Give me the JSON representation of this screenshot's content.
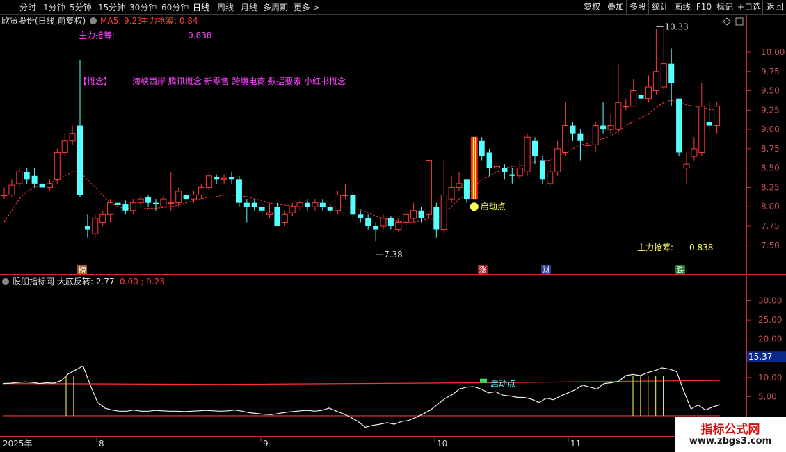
{
  "toolbar": {
    "periods": [
      "分时",
      "1分钟",
      "5分钟",
      "15分钟",
      "30分钟",
      "60分钟",
      "日线",
      "周线",
      "月线",
      "多周期",
      "更多 >"
    ],
    "active_period": "日线",
    "right_buttons": [
      "复权",
      "叠加",
      "多股",
      "统计",
      "画线",
      "F10",
      "标记",
      "+自选",
      "返回"
    ]
  },
  "main": {
    "stock_title": "欣贸股份(日线,前复权)",
    "ma_label": "MA5: 9.23",
    "zl_header": "主力抢筹: 0.84",
    "zl_label": "主力抢筹:",
    "zl_value": "0.838",
    "concept_tag": "【概念】",
    "concepts": "海峡西岸 腾讯概念 新零售 跨境电商 数据要素 小红书概念",
    "start_point_label": "启动点",
    "high_label": "10.33",
    "low_label": "7.38",
    "zl_bottom_label": "主力抢筹:",
    "zl_bottom_value": "0.838",
    "badges": [
      "榜",
      "涨",
      "财",
      "跌"
    ],
    "y_axis": [
      "10.00",
      "9.75",
      "9.50",
      "9.25",
      "9.00",
      "8.75",
      "8.50",
      "8.25",
      "8.00",
      "7.75",
      "7.50"
    ]
  },
  "sub": {
    "indicator_name": "股朋指标网",
    "series_label": "大底反转: 2.77",
    "values_text": "0.00 ; 9.23",
    "start_point_label": "启动点",
    "y_axis": [
      "30.00",
      "25.00",
      "20.00",
      "10.00",
      "5.00"
    ],
    "current_value": "15.37"
  },
  "x_axis": {
    "labels": [
      "2025年",
      "8",
      "9",
      "10",
      "11"
    ]
  },
  "watermark": {
    "title": "指标公式网",
    "url": "www.zbgs3.com"
  },
  "colors": {
    "up": "#ff3a3a",
    "down": "#54ffff",
    "ma": "#ff3a3a",
    "zl": "#ff44ff",
    "gold": "#ffff55",
    "axis": "#c03030"
  },
  "chart_data": {
    "type": "candlestick",
    "title": "欣贸股份(日线,前复权)",
    "ylim": [
      7.3,
      10.45
    ],
    "candles": [
      [
        8.15,
        8.15,
        8.25,
        8.1
      ],
      [
        8.15,
        8.28,
        8.35,
        8.12
      ],
      [
        8.3,
        8.45,
        8.5,
        8.25
      ],
      [
        8.45,
        8.35,
        8.5,
        8.3
      ],
      [
        8.4,
        8.3,
        8.5,
        8.25
      ],
      [
        8.3,
        8.25,
        8.35,
        8.2
      ],
      [
        8.25,
        8.3,
        8.35,
        8.2
      ],
      [
        8.35,
        8.7,
        8.75,
        8.3
      ],
      [
        8.7,
        8.85,
        8.95,
        8.65
      ],
      [
        8.85,
        8.95,
        9.05,
        8.8
      ],
      [
        9.05,
        8.15,
        9.9,
        8.12
      ],
      [
        7.75,
        7.7,
        7.9,
        7.6
      ],
      [
        7.65,
        7.85,
        7.9,
        7.6
      ],
      [
        7.8,
        7.9,
        7.95,
        7.75
      ],
      [
        7.9,
        8.05,
        8.1,
        7.8
      ],
      [
        8.05,
        8.02,
        8.1,
        7.95
      ],
      [
        8.03,
        7.95,
        8.08,
        7.9
      ],
      [
        7.95,
        8.05,
        8.1,
        7.9
      ],
      [
        8.05,
        8.1,
        8.15,
        8.0
      ],
      [
        8.12,
        8.05,
        8.15,
        8.0
      ],
      [
        8.05,
        8.03,
        8.1,
        7.95
      ],
      [
        8.0,
        8.1,
        8.15,
        7.98
      ],
      [
        8.05,
        8.05,
        8.45,
        7.95
      ],
      [
        8.05,
        8.2,
        8.25,
        8.0
      ],
      [
        8.15,
        8.1,
        8.2,
        8.0
      ],
      [
        8.1,
        8.15,
        8.2,
        8.05
      ],
      [
        8.15,
        8.25,
        8.3,
        8.1
      ],
      [
        8.25,
        8.4,
        8.45,
        8.2
      ],
      [
        8.38,
        8.35,
        8.42,
        8.3
      ],
      [
        8.35,
        8.37,
        8.42,
        8.3
      ],
      [
        8.38,
        8.35,
        8.45,
        8.3
      ],
      [
        8.35,
        8.05,
        8.4,
        8.0
      ],
      [
        8.05,
        8.0,
        8.1,
        7.8
      ],
      [
        8.05,
        8.0,
        8.1,
        7.95
      ],
      [
        8.0,
        7.95,
        8.05,
        7.85
      ],
      [
        7.9,
        7.92,
        8.05,
        7.85
      ],
      [
        8.0,
        7.75,
        8.05,
        7.75
      ],
      [
        7.8,
        7.9,
        7.95,
        7.75
      ],
      [
        7.92,
        8.0,
        8.05,
        7.88
      ],
      [
        8.0,
        8.05,
        8.1,
        7.95
      ],
      [
        8.05,
        8.0,
        8.1,
        7.95
      ],
      [
        8.0,
        8.05,
        8.1,
        7.95
      ],
      [
        8.05,
        8.0,
        8.1,
        7.95
      ],
      [
        8.0,
        7.95,
        8.05,
        7.9
      ],
      [
        7.95,
        8.15,
        8.2,
        7.9
      ],
      [
        8.15,
        8.15,
        8.3,
        8.1
      ],
      [
        8.15,
        7.9,
        8.2,
        7.85
      ],
      [
        7.9,
        7.85,
        7.95,
        7.8
      ],
      [
        7.85,
        7.75,
        7.9,
        7.7
      ],
      [
        7.75,
        7.7,
        7.8,
        7.55
      ],
      [
        7.75,
        7.85,
        7.9,
        7.7
      ],
      [
        7.85,
        7.75,
        7.88,
        7.7
      ],
      [
        7.7,
        7.8,
        7.85,
        7.68
      ],
      [
        7.8,
        7.9,
        7.95,
        7.75
      ],
      [
        7.85,
        7.95,
        8.05,
        7.8
      ],
      [
        7.95,
        7.85,
        8.0,
        7.8
      ],
      [
        7.9,
        8.6,
        8.6,
        7.85
      ],
      [
        8.0,
        7.7,
        8.05,
        7.6
      ],
      [
        7.7,
        8.15,
        8.6,
        7.65
      ],
      [
        8.1,
        8.25,
        8.4,
        8.05
      ],
      [
        8.25,
        8.3,
        8.45,
        8.2
      ],
      [
        8.35,
        8.1,
        8.35,
        8.05
      ],
      [
        8.15,
        8.9,
        8.9,
        8.1
      ],
      [
        8.85,
        8.65,
        8.9,
        8.6
      ],
      [
        8.7,
        8.5,
        8.75,
        8.4
      ],
      [
        8.5,
        8.52,
        8.6,
        8.45
      ],
      [
        8.5,
        8.45,
        8.55,
        8.35
      ],
      [
        8.42,
        8.4,
        8.5,
        8.3
      ],
      [
        8.4,
        8.5,
        8.6,
        8.35
      ],
      [
        8.45,
        8.9,
        8.95,
        8.4
      ],
      [
        8.85,
        8.65,
        8.9,
        8.55
      ],
      [
        8.6,
        8.35,
        8.65,
        8.3
      ],
      [
        8.3,
        8.45,
        8.55,
        8.25
      ],
      [
        8.45,
        8.75,
        8.85,
        8.4
      ],
      [
        8.7,
        9.05,
        9.35,
        8.65
      ],
      [
        9.05,
        8.95,
        9.1,
        8.85
      ],
      [
        8.95,
        8.85,
        9.0,
        8.6
      ],
      [
        8.8,
        8.8,
        8.95,
        8.75
      ],
      [
        8.8,
        9.05,
        9.1,
        8.7
      ],
      [
        9.05,
        9.0,
        9.35,
        8.95
      ],
      [
        9.0,
        9.05,
        9.2,
        8.95
      ],
      [
        9.0,
        9.35,
        9.85,
        8.95
      ],
      [
        9.3,
        9.3,
        9.4,
        9.25
      ],
      [
        9.3,
        9.5,
        9.65,
        9.3
      ],
      [
        9.45,
        9.4,
        9.55,
        9.35
      ],
      [
        9.4,
        9.55,
        9.7,
        9.35
      ],
      [
        9.5,
        9.75,
        10.3,
        9.45
      ],
      [
        9.55,
        9.85,
        10.33,
        9.5
      ],
      [
        9.85,
        9.6,
        10.05,
        9.3
      ],
      [
        9.4,
        8.7,
        9.35,
        8.65
      ],
      [
        8.5,
        8.55,
        8.7,
        8.3
      ],
      [
        8.65,
        8.75,
        8.9,
        8.6
      ],
      [
        8.7,
        9.3,
        9.6,
        8.65
      ],
      [
        9.1,
        9.05,
        9.35,
        9.0
      ],
      [
        9.05,
        9.3,
        9.35,
        8.95
      ]
    ],
    "ma5": [
      7.8,
      7.95,
      8.1,
      8.2,
      8.25,
      8.28,
      8.3,
      8.35,
      8.4,
      8.45,
      8.45,
      8.35,
      8.25,
      8.15,
      8.05,
      8.0,
      7.98,
      7.97,
      7.97,
      7.98,
      7.98,
      7.99,
      8.0,
      8.02,
      8.05,
      8.08,
      8.1,
      8.12,
      8.13,
      8.15,
      8.15,
      8.14,
      8.13,
      8.1,
      8.08,
      8.05,
      8.03,
      8.02,
      8.01,
      8.0,
      8.0,
      8.0,
      8.0,
      8.0,
      8.0,
      8.0,
      7.98,
      7.96,
      7.92,
      7.88,
      7.85,
      7.83,
      7.81,
      7.8,
      7.8,
      7.82,
      7.85,
      7.85,
      7.9,
      8.0,
      8.1,
      8.15,
      8.25,
      8.35,
      8.4,
      8.45,
      8.5,
      8.52,
      8.53,
      8.55,
      8.58,
      8.6,
      8.6,
      8.65,
      8.7,
      8.75,
      8.8,
      8.82,
      8.85,
      8.88,
      8.92,
      8.98,
      9.05,
      9.1,
      9.15,
      9.2,
      9.28,
      9.35,
      9.38,
      9.35,
      9.32,
      9.3,
      9.28,
      9.26,
      9.25
    ]
  },
  "sub_chart_data": {
    "type": "line",
    "series": [
      {
        "name": "大底反转",
        "values": [
          8.4,
          8.5,
          8.7,
          8.8,
          8.7,
          8.4,
          8.6,
          8.5,
          9.2,
          11,
          12,
          13,
          8,
          3.5,
          2,
          1.5,
          1.2,
          1.2,
          1.5,
          1.2,
          1.2,
          1.4,
          1.3,
          1.2,
          1.2,
          1.1,
          1.2,
          1.3,
          1.4,
          1.3,
          1.2,
          1.3,
          1.5,
          1.2,
          0.8,
          0.6,
          0.4,
          0.3,
          0.6,
          0.9,
          1.1,
          1.3,
          1.4,
          1.2,
          1.4,
          2.0,
          1.2,
          0.5,
          -0.4,
          -1.5,
          -3,
          -2.5,
          -2.2,
          -1.8,
          -2.2,
          -1.5,
          -1.2,
          -0.4,
          0.5,
          1.5,
          3,
          4.5,
          5.5,
          7,
          7.5,
          7.6,
          7,
          6,
          6.3,
          5.4,
          5.2,
          4.8,
          4.8,
          4.3,
          3.5,
          4.6,
          4.2,
          5.2,
          6,
          6.8,
          8,
          7.5,
          7,
          8.4,
          8.6,
          9,
          10.5,
          10.8,
          10.5,
          11.3,
          11.8,
          12.5,
          12.2,
          11.6,
          6.5,
          1.8,
          2.8,
          1.5,
          2.3,
          2.9
        ]
      },
      {
        "name": "0.00",
        "values": [
          0
        ]
      },
      {
        "name": "9.23",
        "values": [
          9.23
        ]
      }
    ],
    "ylim": [
      -4,
      35
    ]
  }
}
